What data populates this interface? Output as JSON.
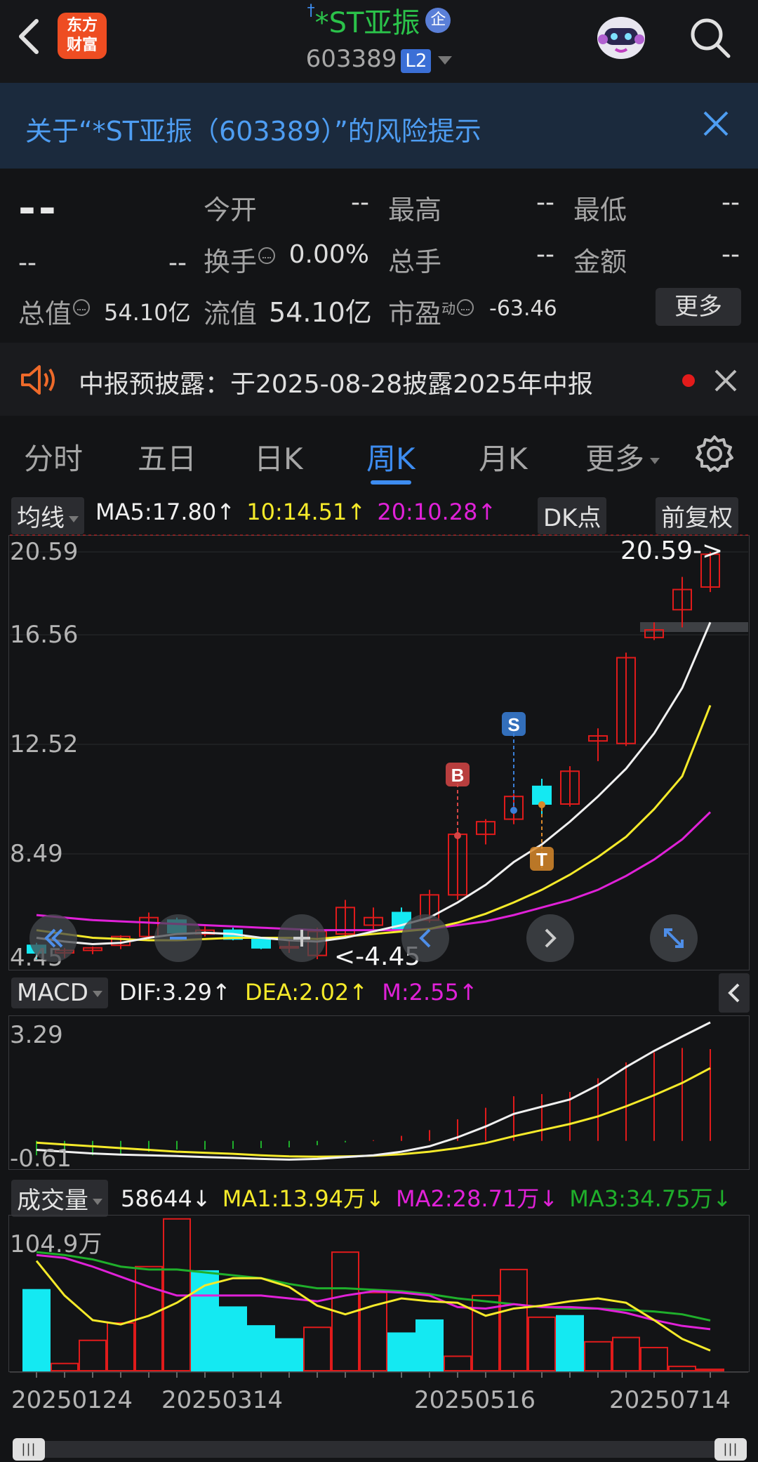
{
  "header": {
    "logo_line1": "东方",
    "logo_line2": "财富",
    "title": "*ST亚振",
    "title_badge": "企",
    "code": "603389",
    "level_badge": "L2",
    "icons": [
      "back-icon",
      "robot-avatar-icon",
      "search-icon"
    ]
  },
  "risk_banner": {
    "text": "关于“*ST亚振（603389）”的风险提示"
  },
  "quote": {
    "price": "--",
    "change": "--",
    "change_pct": "--",
    "open_label": "今开",
    "open_value": "--",
    "high_label": "最高",
    "high_value": "--",
    "low_label": "最低",
    "low_value": "--",
    "turnover_label": "换手",
    "turnover_value": "0.00%",
    "volume_label": "总手",
    "volume_value": "--",
    "amount_label": "金额",
    "amount_value": "--",
    "total_cap_label": "总值",
    "total_cap_value": "54.10亿",
    "float_cap_label": "流值",
    "float_cap_value": "54.10亿",
    "pe_label": "市盈",
    "pe_sup": "动",
    "pe_value": "-63.46",
    "more_label": "更多"
  },
  "notice": {
    "text": "中报预披露：于2025-08-28披露2025年中报"
  },
  "tabs": [
    {
      "label": "分时"
    },
    {
      "label": "五日"
    },
    {
      "label": "日K"
    },
    {
      "label": "周K"
    },
    {
      "label": "月K"
    },
    {
      "label": "更多"
    }
  ],
  "active_tab": "周K",
  "indicators": {
    "ma_selector": "均线",
    "ma5": "MA5:17.80",
    "ma10": "10:14.51",
    "ma20": "20:10.28",
    "dk_button": "DK点",
    "adjust_button": "前复权",
    "macd_selector": "MACD",
    "dif": "DIF:3.29",
    "dea": "DEA:2.02",
    "m": "M:2.55",
    "vol_selector": "成交量",
    "vol": "58644",
    "vol_ma1": "MA1:13.94万",
    "vol_ma2": "MA2:28.71万",
    "vol_ma3": "MA3:34.75万",
    "arrows": {
      "up": "↑",
      "down": "↓"
    }
  },
  "chart_data": [
    {
      "type": "candlestick",
      "title": "周K",
      "y_ticks": [
        "20.59",
        "16.56",
        "12.52",
        "8.49",
        "4.45"
      ],
      "ylim": [
        4.45,
        20.59
      ],
      "annotations": {
        "high": "20.59->",
        "low": "<-4.45",
        "markers": [
          "B",
          "S",
          "T"
        ]
      },
      "x_tick_labels": [
        "20250124",
        "20250314",
        "20250516",
        "20250714"
      ],
      "candles": [
        {
          "o": 5.0,
          "h": 5.1,
          "l": 4.45,
          "c": 4.7
        },
        {
          "o": 4.7,
          "h": 4.9,
          "l": 4.5,
          "c": 4.8
        },
        {
          "o": 4.8,
          "h": 4.95,
          "l": 4.65,
          "c": 4.9
        },
        {
          "o": 5.0,
          "h": 5.4,
          "l": 4.85,
          "c": 5.35
        },
        {
          "o": 5.35,
          "h": 6.3,
          "l": 5.2,
          "c": 6.1
        },
        {
          "o": 6.0,
          "h": 6.1,
          "l": 5.45,
          "c": 5.5
        },
        {
          "o": 5.45,
          "h": 5.75,
          "l": 5.35,
          "c": 5.6
        },
        {
          "o": 5.6,
          "h": 5.7,
          "l": 5.2,
          "c": 5.25
        },
        {
          "o": 5.25,
          "h": 5.3,
          "l": 4.85,
          "c": 4.9
        },
        {
          "o": 4.9,
          "h": 5.2,
          "l": 4.7,
          "c": 4.95
        },
        {
          "o": 4.6,
          "h": 5.7,
          "l": 4.45,
          "c": 5.55
        },
        {
          "o": 5.45,
          "h": 6.8,
          "l": 5.35,
          "c": 6.5
        },
        {
          "o": 5.8,
          "h": 6.5,
          "l": 5.55,
          "c": 6.1
        },
        {
          "o": 6.3,
          "h": 6.5,
          "l": 5.5,
          "c": 5.6
        },
        {
          "o": 6.0,
          "h": 7.2,
          "l": 5.9,
          "c": 7.0
        },
        {
          "o": 7.0,
          "h": 9.6,
          "l": 6.8,
          "c": 9.4
        },
        {
          "o": 9.4,
          "h": 10.0,
          "l": 9.0,
          "c": 9.9
        },
        {
          "o": 10.0,
          "h": 11.0,
          "l": 9.8,
          "c": 10.9
        },
        {
          "o": 11.3,
          "h": 11.6,
          "l": 10.2,
          "c": 10.6
        },
        {
          "o": 10.6,
          "h": 12.1,
          "l": 10.5,
          "c": 11.9
        },
        {
          "o": 13.1,
          "h": 13.6,
          "l": 12.3,
          "c": 13.3
        },
        {
          "o": 13.0,
          "h": 16.6,
          "l": 12.9,
          "c": 16.4
        },
        {
          "o": 17.2,
          "h": 17.8,
          "l": 17.1,
          "c": 17.5
        },
        {
          "o": 18.3,
          "h": 19.6,
          "l": 17.6,
          "c": 19.1
        },
        {
          "o": 19.2,
          "h": 20.59,
          "l": 19.0,
          "c": 20.5
        }
      ],
      "ma": {
        "MA5": [
          5.3,
          5.15,
          5.05,
          5.1,
          5.3,
          5.45,
          5.5,
          5.45,
          5.3,
          5.2,
          5.15,
          5.3,
          5.55,
          5.8,
          6.1,
          6.7,
          7.4,
          8.3,
          9.0,
          9.9,
          10.9,
          12.0,
          13.4,
          15.2,
          17.8
        ],
        "MA10": [
          5.6,
          5.45,
          5.3,
          5.25,
          5.2,
          5.2,
          5.25,
          5.3,
          5.3,
          5.3,
          5.25,
          5.35,
          5.45,
          5.55,
          5.65,
          5.9,
          6.25,
          6.7,
          7.2,
          7.8,
          8.5,
          9.3,
          10.4,
          11.7,
          14.51
        ],
        "MA20": [
          6.2,
          6.1,
          6.0,
          5.95,
          5.9,
          5.85,
          5.8,
          5.75,
          5.7,
          5.65,
          5.6,
          5.6,
          5.6,
          5.6,
          5.65,
          5.8,
          5.95,
          6.2,
          6.5,
          6.8,
          7.2,
          7.75,
          8.4,
          9.2,
          10.28
        ]
      }
    },
    {
      "type": "macd",
      "y_ticks": [
        "3.29",
        "-0.61"
      ],
      "ylim": [
        -0.61,
        3.29
      ],
      "dif": [
        -0.25,
        -0.3,
        -0.35,
        -0.38,
        -0.4,
        -0.42,
        -0.45,
        -0.47,
        -0.5,
        -0.52,
        -0.5,
        -0.45,
        -0.4,
        -0.3,
        -0.15,
        0.1,
        0.4,
        0.75,
        0.95,
        1.15,
        1.55,
        2.05,
        2.5,
        2.9,
        3.29
      ],
      "dea": [
        -0.05,
        -0.1,
        -0.15,
        -0.2,
        -0.25,
        -0.3,
        -0.33,
        -0.36,
        -0.4,
        -0.43,
        -0.44,
        -0.43,
        -0.41,
        -0.37,
        -0.3,
        -0.2,
        -0.06,
        0.13,
        0.3,
        0.47,
        0.68,
        0.96,
        1.27,
        1.61,
        2.02
      ],
      "m": [
        -0.4,
        -0.4,
        -0.4,
        -0.36,
        -0.3,
        -0.24,
        -0.24,
        -0.22,
        -0.2,
        -0.18,
        -0.12,
        -0.04,
        0.02,
        0.14,
        0.3,
        0.6,
        0.92,
        1.24,
        1.3,
        1.36,
        1.74,
        2.18,
        2.46,
        2.58,
        2.55
      ]
    },
    {
      "type": "bar",
      "title": "成交量",
      "y_ticks": [
        "104.9万"
      ],
      "ylim": [
        0,
        104.9
      ],
      "values": [
        56,
        5,
        21,
        33,
        72,
        105,
        69,
        44,
        31,
        22,
        30,
        82,
        54,
        26,
        35,
        10,
        52,
        70,
        37,
        38,
        20,
        23,
        16,
        3,
        1
      ],
      "down": [
        true,
        false,
        false,
        false,
        false,
        false,
        true,
        true,
        true,
        true,
        false,
        false,
        false,
        true,
        true,
        false,
        false,
        false,
        false,
        true,
        false,
        false,
        false,
        false,
        false
      ],
      "ma": {
        "MA1": [
          76,
          52,
          35,
          32,
          38,
          47,
          59,
          64,
          64,
          58,
          45,
          39,
          45,
          50,
          48,
          47,
          38,
          43,
          45,
          48,
          50,
          47,
          35,
          22,
          13.94
        ],
        "MA2": [
          80,
          78,
          72,
          65,
          58,
          52,
          52,
          52,
          52,
          50,
          48,
          52,
          55,
          54,
          52,
          44,
          43,
          46,
          44,
          44,
          43,
          40,
          35,
          31,
          28.71
        ],
        "MA3": [
          82,
          80,
          77,
          72,
          70,
          70,
          68,
          66,
          64,
          60,
          57,
          57,
          56,
          55,
          53,
          50,
          48,
          46,
          44,
          43,
          43,
          42,
          41,
          39,
          34.75
        ]
      }
    }
  ],
  "colors": {
    "up": "#e01b1b",
    "down": "#14e9f2",
    "ma_white": "#f0f0f0",
    "ma_yellow": "#f5ea2a",
    "ma_magenta": "#e021d8",
    "ma_green": "#1faf2b",
    "accent_blue": "#3d8cf0"
  }
}
